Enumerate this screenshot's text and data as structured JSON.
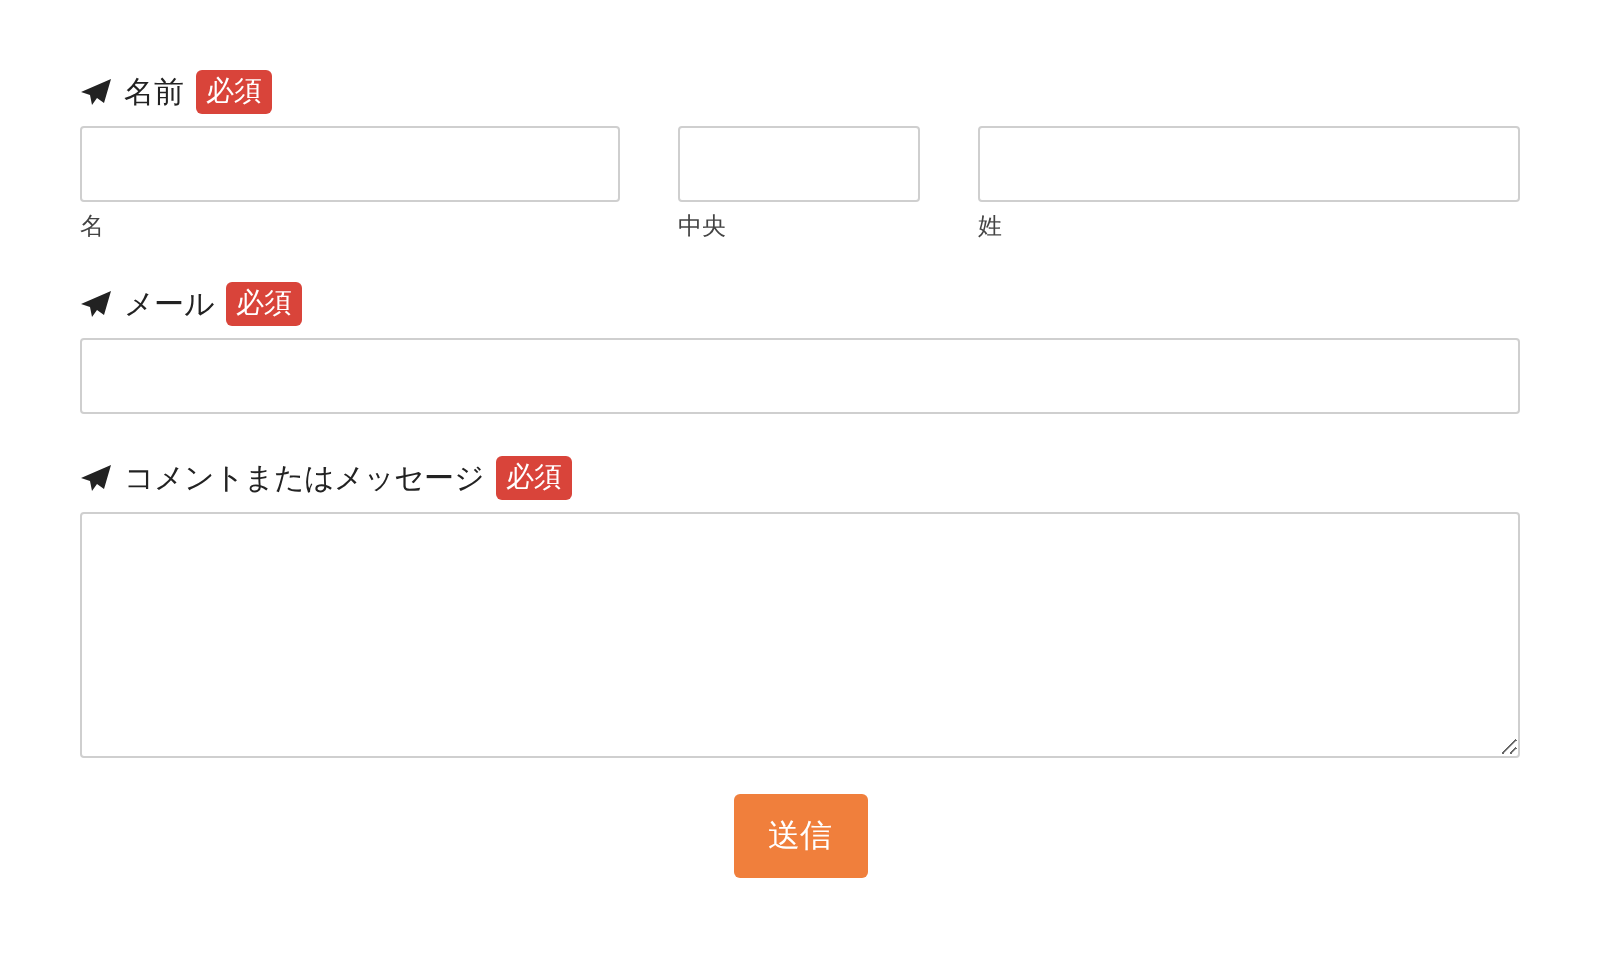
{
  "fields": [
    {
      "kind": "name",
      "label": "名前",
      "badge": "必須",
      "parts": [
        "名",
        "中央",
        "姓"
      ]
    },
    {
      "kind": "text",
      "label": "メール",
      "badge": "必須"
    },
    {
      "kind": "textarea",
      "label": "コメントまたはメッセージ",
      "badge": "必須"
    }
  ],
  "submit": "送信"
}
